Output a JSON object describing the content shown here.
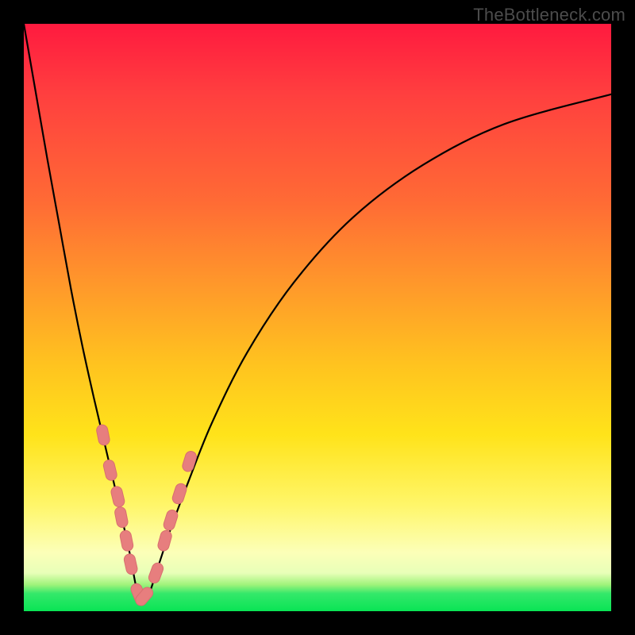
{
  "watermark": "TheBottleneck.com",
  "colors": {
    "page_bg": "#000000",
    "curve": "#000000",
    "marker_fill": "#e77e7e",
    "marker_stroke": "#d86f6f"
  },
  "chart_data": {
    "type": "line",
    "title": "",
    "xlabel": "",
    "ylabel": "",
    "xlim": [
      0,
      100
    ],
    "ylim": [
      0,
      100
    ],
    "grid": false,
    "note": "Bottleneck-style V curve. x is a normalized hardware ratio; y is bottleneck severity (0 = balanced, 100 = worst). Values estimated from pixel positions.",
    "series": [
      {
        "name": "bottleneck-curve",
        "x": [
          0,
          2,
          4,
          6,
          8,
          10,
          12,
          14,
          16,
          18,
          19.6,
          21,
          23,
          25,
          28,
          32,
          38,
          46,
          56,
          68,
          82,
          100
        ],
        "y": [
          100,
          88.5,
          77,
          66,
          55,
          45,
          36,
          27.5,
          19,
          10,
          2.2,
          2.2,
          8,
          14,
          22,
          32,
          44,
          56,
          67,
          76,
          83,
          88
        ]
      }
    ],
    "markers": {
      "name": "highlight-points",
      "note": "Pink capsule-shaped sample markers clustered near the minimum on both branches.",
      "points": [
        {
          "x": 13.5,
          "y": 30.0
        },
        {
          "x": 14.7,
          "y": 24.0
        },
        {
          "x": 16.0,
          "y": 19.5
        },
        {
          "x": 16.6,
          "y": 16.0
        },
        {
          "x": 17.5,
          "y": 12.0
        },
        {
          "x": 18.2,
          "y": 8.0
        },
        {
          "x": 19.5,
          "y": 3.0
        },
        {
          "x": 20.5,
          "y": 2.5
        },
        {
          "x": 22.5,
          "y": 6.5
        },
        {
          "x": 24.0,
          "y": 12.0
        },
        {
          "x": 25.0,
          "y": 15.5
        },
        {
          "x": 26.5,
          "y": 20.0
        },
        {
          "x": 28.2,
          "y": 25.5
        }
      ]
    }
  }
}
